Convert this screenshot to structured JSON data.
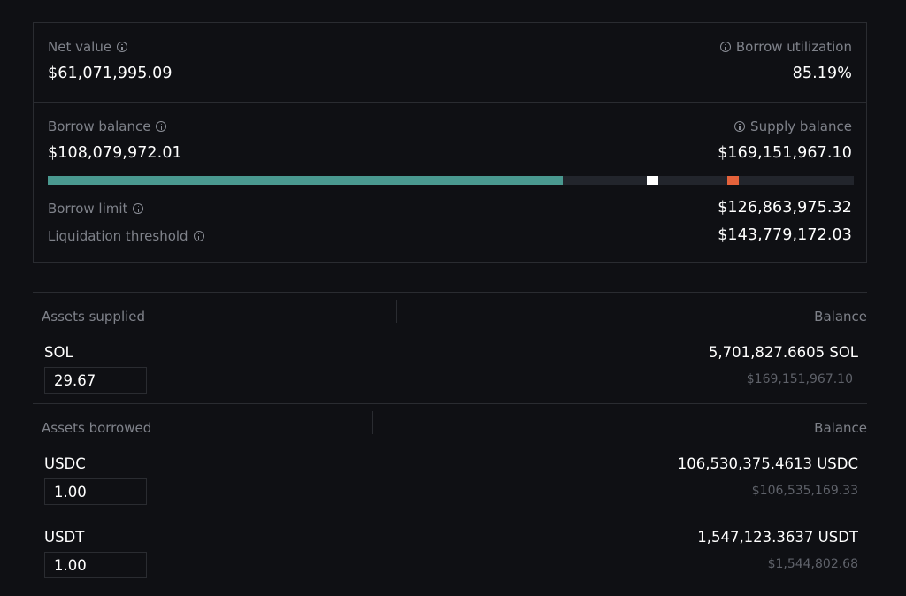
{
  "summary": {
    "net_value": {
      "label": "Net value",
      "value": "$61,071,995.09"
    },
    "borrow_utilization": {
      "label": "Borrow utilization",
      "value": "85.19%"
    },
    "borrow_balance": {
      "label": "Borrow balance",
      "value": "$108,079,972.01"
    },
    "supply_balance": {
      "label": "Supply balance",
      "value": "$169,151,967.10"
    },
    "borrow_limit": {
      "label": "Borrow limit",
      "value": "$126,863,975.32"
    },
    "liquidation_threshold": {
      "label": "Liquidation threshold",
      "value": "$143,779,172.03"
    }
  },
  "progress": {
    "borrow_fraction": 0.639,
    "borrow_limit_fraction": 0.75,
    "liquidation_fraction": 0.85,
    "colors": {
      "fill": "#4a9990",
      "track": "#22252c",
      "limit_marker": "#ffffff",
      "liquidation_marker": "#e4623b"
    }
  },
  "supplied": {
    "header_left": "Assets supplied",
    "header_right": "Balance",
    "rows": [
      {
        "asset": "SOL",
        "input_value": "29.67",
        "balance": "5,701,827.6605 SOL",
        "balance_usd": "$169,151,967.10"
      }
    ]
  },
  "borrowed": {
    "header_left": "Assets borrowed",
    "header_right": "Balance",
    "rows": [
      {
        "asset": "USDC",
        "input_value": "1.00",
        "balance": "106,530,375.4613 USDC",
        "balance_usd": "$106,535,169.33"
      },
      {
        "asset": "USDT",
        "input_value": "1.00",
        "balance": "1,547,123.3637 USDT",
        "balance_usd": "$1,544,802.68"
      }
    ]
  },
  "icons": {
    "info": "info-icon"
  }
}
